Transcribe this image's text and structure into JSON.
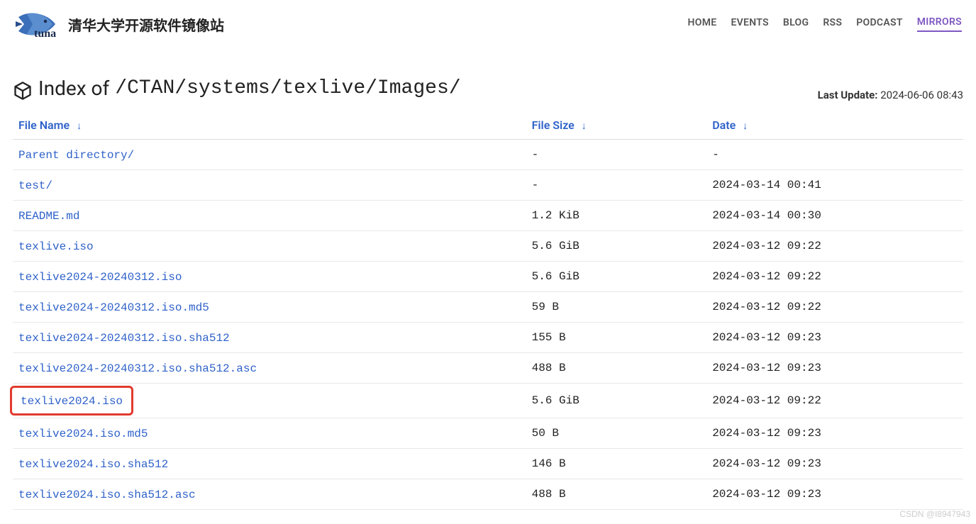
{
  "site_title": "清华大学开源软件镜像站",
  "nav": [
    {
      "label": "HOME",
      "active": false
    },
    {
      "label": "EVENTS",
      "active": false
    },
    {
      "label": "BLOG",
      "active": false
    },
    {
      "label": "RSS",
      "active": false
    },
    {
      "label": "PODCAST",
      "active": false
    },
    {
      "label": "MIRRORS",
      "active": true
    }
  ],
  "index_prefix": "Index of ",
  "index_path": "/CTAN/systems/texlive/Images/",
  "last_update_label": "Last Update:",
  "last_update_value": "2024-06-06 08:43",
  "columns": {
    "name": "File Name",
    "size": "File Size",
    "date": "Date"
  },
  "sort_arrow": "↓",
  "rows": [
    {
      "name": "Parent directory/",
      "size": "-",
      "date": "-",
      "highlight": false
    },
    {
      "name": "test/",
      "size": "-",
      "date": "2024-03-14 00:41",
      "highlight": false
    },
    {
      "name": "README.md",
      "size": "1.2 KiB",
      "date": "2024-03-14 00:30",
      "highlight": false
    },
    {
      "name": "texlive.iso",
      "size": "5.6 GiB",
      "date": "2024-03-12 09:22",
      "highlight": false
    },
    {
      "name": "texlive2024-20240312.iso",
      "size": "5.6 GiB",
      "date": "2024-03-12 09:22",
      "highlight": false
    },
    {
      "name": "texlive2024-20240312.iso.md5",
      "size": "59 B",
      "date": "2024-03-12 09:22",
      "highlight": false
    },
    {
      "name": "texlive2024-20240312.iso.sha512",
      "size": "155 B",
      "date": "2024-03-12 09:23",
      "highlight": false
    },
    {
      "name": "texlive2024-20240312.iso.sha512.asc",
      "size": "488 B",
      "date": "2024-03-12 09:23",
      "highlight": false
    },
    {
      "name": "texlive2024.iso",
      "size": "5.6 GiB",
      "date": "2024-03-12 09:22",
      "highlight": true
    },
    {
      "name": "texlive2024.iso.md5",
      "size": "50 B",
      "date": "2024-03-12 09:23",
      "highlight": false
    },
    {
      "name": "texlive2024.iso.sha512",
      "size": "146 B",
      "date": "2024-03-12 09:23",
      "highlight": false
    },
    {
      "name": "texlive2024.iso.sha512.asc",
      "size": "488 B",
      "date": "2024-03-12 09:23",
      "highlight": false
    }
  ],
  "watermark": "CSDN @I8947943"
}
